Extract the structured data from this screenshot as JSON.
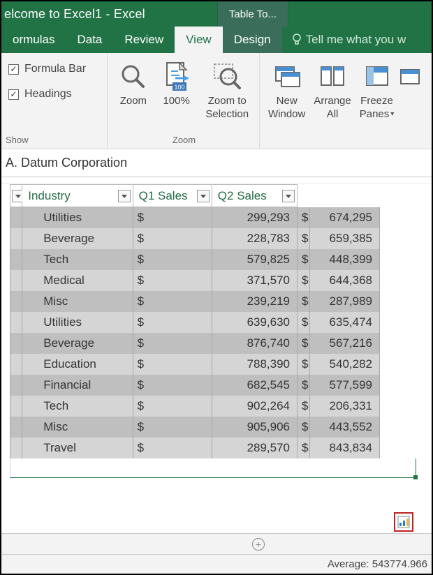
{
  "titlebar": {
    "title": "elcome to Excel1 - Excel",
    "context_tab": "Table To..."
  },
  "tabs": {
    "formulas": "ormulas",
    "data": "Data",
    "review": "Review",
    "view": "View",
    "design": "Design",
    "tellme": "Tell me what you w"
  },
  "ribbon": {
    "show": {
      "label": "Show",
      "formula_bar": "Formula Bar",
      "headings": "Headings"
    },
    "zoom": {
      "label": "Zoom",
      "zoom": "Zoom",
      "hundred": "100%",
      "zoom_selection_l1": "Zoom to",
      "zoom_selection_l2": "Selection"
    },
    "window": {
      "new_l1": "New",
      "new_l2": "Window",
      "arrange_l1": "Arrange",
      "arrange_l2": "All",
      "freeze_l1": "Freeze",
      "freeze_l2": "Panes"
    }
  },
  "formula_bar_text": "A. Datum Corporation",
  "headers": {
    "industry": "Industry",
    "q1": "Q1 Sales",
    "q2": "Q2 Sales"
  },
  "rows": [
    {
      "industry": "Utilities",
      "q1": "299,293",
      "q2": "674,295"
    },
    {
      "industry": "Beverage",
      "q1": "228,783",
      "q2": "659,385"
    },
    {
      "industry": "Tech",
      "q1": "579,825",
      "q2": "448,399"
    },
    {
      "industry": "Medical",
      "q1": "371,570",
      "q2": "644,368"
    },
    {
      "industry": "Misc",
      "q1": "239,219",
      "q2": "287,989"
    },
    {
      "industry": "Utilities",
      "q1": "639,630",
      "q2": "635,474"
    },
    {
      "industry": "Beverage",
      "q1": "876,740",
      "q2": "567,216"
    },
    {
      "industry": "Education",
      "q1": "788,390",
      "q2": "540,282"
    },
    {
      "industry": "Financial",
      "q1": "682,545",
      "q2": "577,599"
    },
    {
      "industry": "Tech",
      "q1": "902,264",
      "q2": "206,331"
    },
    {
      "industry": "Misc",
      "q1": "905,906",
      "q2": "443,552"
    },
    {
      "industry": "Travel",
      "q1": "289,570",
      "q2": "843,834"
    }
  ],
  "currency": "$",
  "status": {
    "average": "Average: 543774.966"
  }
}
